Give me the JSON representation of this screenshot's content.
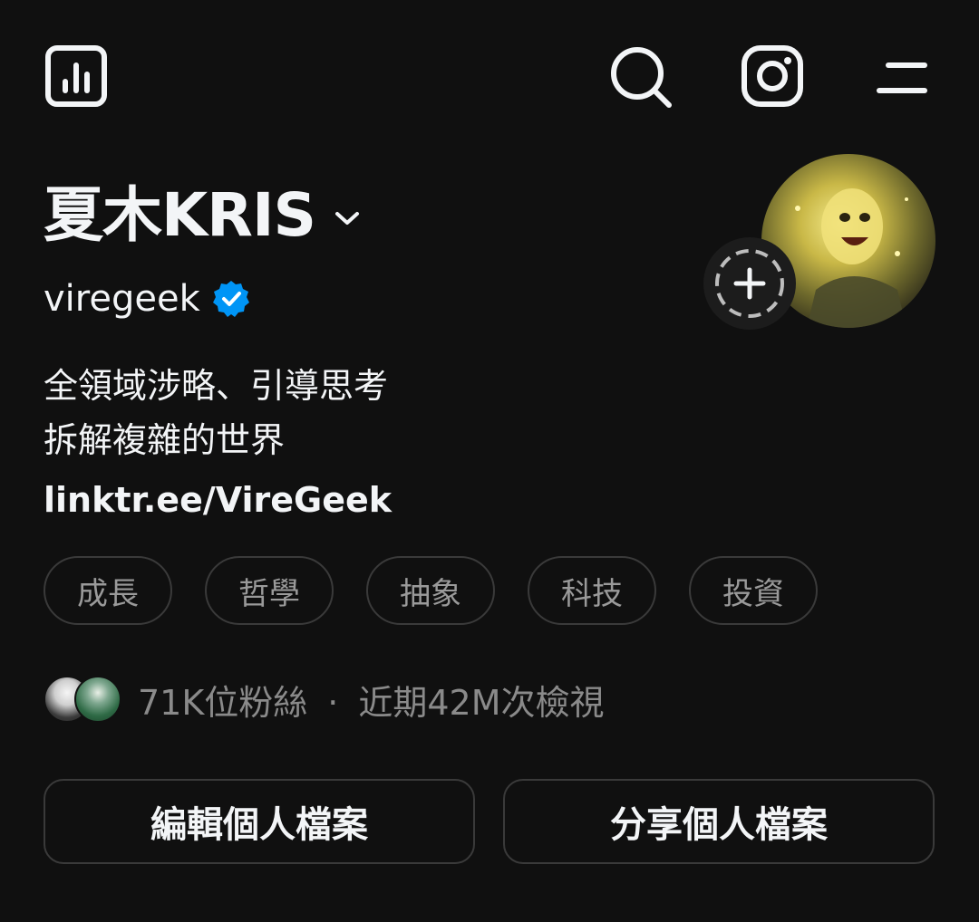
{
  "header": {
    "insights_icon": "bar-chart-icon",
    "search_icon": "search-icon",
    "instagram_icon": "instagram-icon",
    "menu_icon": "menu-icon"
  },
  "profile": {
    "display_name": "夏木KRIS",
    "username": "viregeek",
    "verified": true,
    "bio_lines": [
      "全領域涉略、引導思考",
      "拆解複雜的世界"
    ],
    "link": "linktr.ee/VireGeek"
  },
  "tags": [
    "成長",
    "哲學",
    "抽象",
    "科技",
    "投資"
  ],
  "stats": {
    "followers": "71K位粉絲",
    "separator": "·",
    "views": "近期42M次檢視"
  },
  "actions": {
    "edit_label": "編輯個人檔案",
    "share_label": "分享個人檔案"
  },
  "colors": {
    "background": "#101010",
    "text": "#f3f5f7",
    "muted": "#8a8a8a",
    "verified": "#0095f6",
    "border": "#3a3a3a"
  }
}
